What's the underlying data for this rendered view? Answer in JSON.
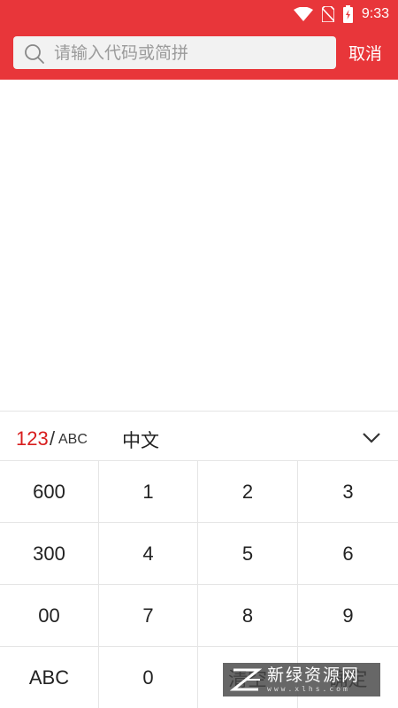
{
  "status_bar": {
    "time": "9:33",
    "icons": [
      "wifi-icon",
      "no-sim-icon",
      "battery-charging-icon"
    ]
  },
  "search": {
    "placeholder": "请输入代码或简拼",
    "value": "",
    "cancel_label": "取消"
  },
  "keyboard": {
    "mode_numeric": "123",
    "mode_separator": "/",
    "mode_alpha": "ABC",
    "mode_chinese": "中文",
    "active_mode": "123",
    "collapse_icon": "chevron-down-icon",
    "keys": [
      "600",
      "1",
      "2",
      "3",
      "300",
      "4",
      "5",
      "6",
      "00",
      "7",
      "8",
      "9",
      "ABC",
      "0",
      "清空",
      "确定"
    ]
  },
  "watermark": {
    "text": "新绿资源网",
    "url": "www.xlhs.com"
  },
  "colors": {
    "header": "#e8363a",
    "active_mode": "#d81e1e"
  }
}
